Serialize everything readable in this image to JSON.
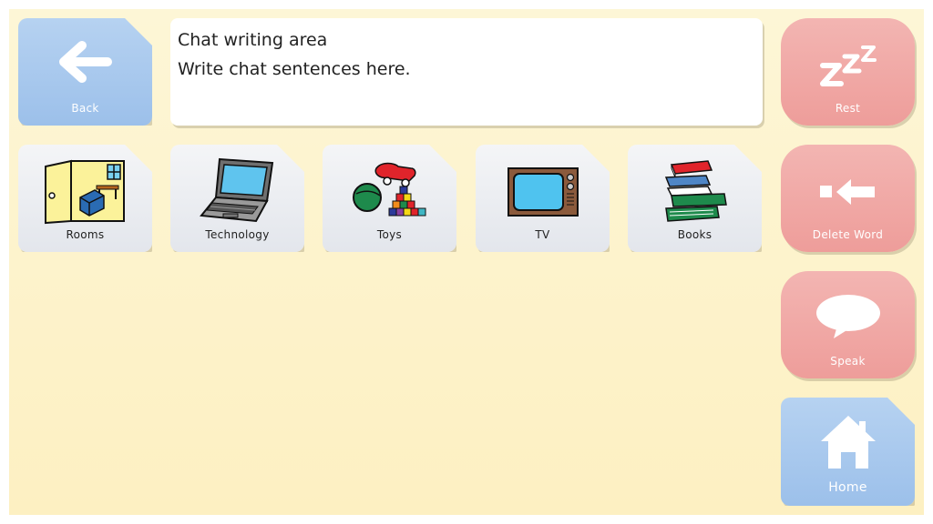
{
  "chat": {
    "title": "Chat writing area",
    "placeholder": "Write chat sentences here."
  },
  "nav": {
    "back_label": "Back",
    "home_label": "Home"
  },
  "actions": {
    "rest_label": "Rest",
    "delete_label": "Delete Word",
    "speak_label": "Speak"
  },
  "categories": [
    {
      "label": "Rooms",
      "icon": "rooms-icon"
    },
    {
      "label": "Technology",
      "icon": "laptop-icon"
    },
    {
      "label": "Toys",
      "icon": "toys-icon"
    },
    {
      "label": "TV",
      "icon": "tv-icon"
    },
    {
      "label": "Books",
      "icon": "books-icon"
    }
  ],
  "colors": {
    "nav_blue": "#9cc0ea",
    "action_red": "#ee9d9a",
    "background": "#fdf4cf"
  }
}
